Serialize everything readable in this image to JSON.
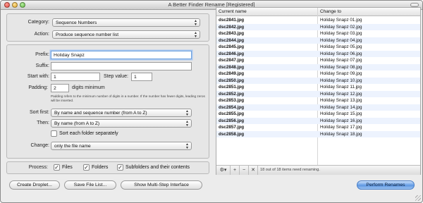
{
  "window": {
    "title": "A Better Finder Rename [Registered]"
  },
  "form": {
    "category_label": "Category:",
    "category_value": "Sequence Numbers",
    "action_label": "Action:",
    "action_value": "Produce sequence number list",
    "prefix_label": "Prefix:",
    "prefix_value": "Holiday Snapz ",
    "suffix_label": "Suffix:",
    "suffix_value": "",
    "start_label": "Start with:",
    "start_value": "1",
    "step_label": "Step value:",
    "step_value": "1",
    "padding_label": "Padding:",
    "padding_value": "2",
    "padding_unit": "digits minimum",
    "padding_note": "Padding refers to the minimum number of digits in a number. If the number has fewer digits, leading zeros will be inserted.",
    "sort_first_label": "Sort first:",
    "sort_first_value": "By name and sequence number (from A to Z)",
    "then_label": "Then:",
    "then_value": "By name (from A to Z)",
    "sort_each_label": "Sort each folder separately",
    "sort_each_checked": false,
    "change_label": "Change:",
    "change_value": "only the file name"
  },
  "process": {
    "label": "Process:",
    "files_label": "Files",
    "files_checked": true,
    "folders_label": "Folders",
    "folders_checked": true,
    "subfolders_label": "Subfolders and their contents",
    "subfolders_checked": true
  },
  "buttons": {
    "create_droplet": "Create Droplet...",
    "save_file_list": "Save File List...",
    "show_multistep": "Show Multi-Step Interface",
    "perform_renames": "Perform Renames"
  },
  "table": {
    "col_current": "Current name",
    "col_change": "Change to",
    "rows": [
      {
        "current": "dsc2841.jpg",
        "change": "Holiday Snapz 01.jpg"
      },
      {
        "current": "dsc2842.jpg",
        "change": "Holiday Snapz 02.jpg"
      },
      {
        "current": "dsc2843.jpg",
        "change": "Holiday Snapz 03.jpg"
      },
      {
        "current": "dsc2844.jpg",
        "change": "Holiday Snapz 04.jpg"
      },
      {
        "current": "dsc2845.jpg",
        "change": "Holiday Snapz 05.jpg"
      },
      {
        "current": "dsc2846.jpg",
        "change": "Holiday Snapz 06.jpg"
      },
      {
        "current": "dsc2847.jpg",
        "change": "Holiday Snapz 07.jpg"
      },
      {
        "current": "dsc2848.jpg",
        "change": "Holiday Snapz 08.jpg"
      },
      {
        "current": "dsc2849.jpg",
        "change": "Holiday Snapz 09.jpg"
      },
      {
        "current": "dsc2850.jpg",
        "change": "Holiday Snapz 10.jpg"
      },
      {
        "current": "dsc2851.jpg",
        "change": "Holiday Snapz 11.jpg"
      },
      {
        "current": "dsc2852.jpg",
        "change": "Holiday Snapz 12.jpg"
      },
      {
        "current": "dsc2853.jpg",
        "change": "Holiday Snapz 13.jpg"
      },
      {
        "current": "dsc2854.jpg",
        "change": "Holiday Snapz 14.jpg"
      },
      {
        "current": "dsc2855.jpg",
        "change": "Holiday Snapz 15.jpg"
      },
      {
        "current": "dsc2856.jpg",
        "change": "Holiday Snapz 16.jpg"
      },
      {
        "current": "dsc2857.jpg",
        "change": "Holiday Snapz 17.jpg"
      },
      {
        "current": "dsc2858.jpg",
        "change": "Holiday Snapz 18.jpg"
      }
    ]
  },
  "list_toolbar": {
    "gear_symbol": "⚙▾",
    "add_symbol": "+",
    "remove_symbol": "−",
    "clear_symbol": "✕",
    "status": "18 out of 18 items need renaming."
  },
  "colors": {
    "accent": "#5a94e0",
    "row_stripe": "#edf3fe"
  }
}
